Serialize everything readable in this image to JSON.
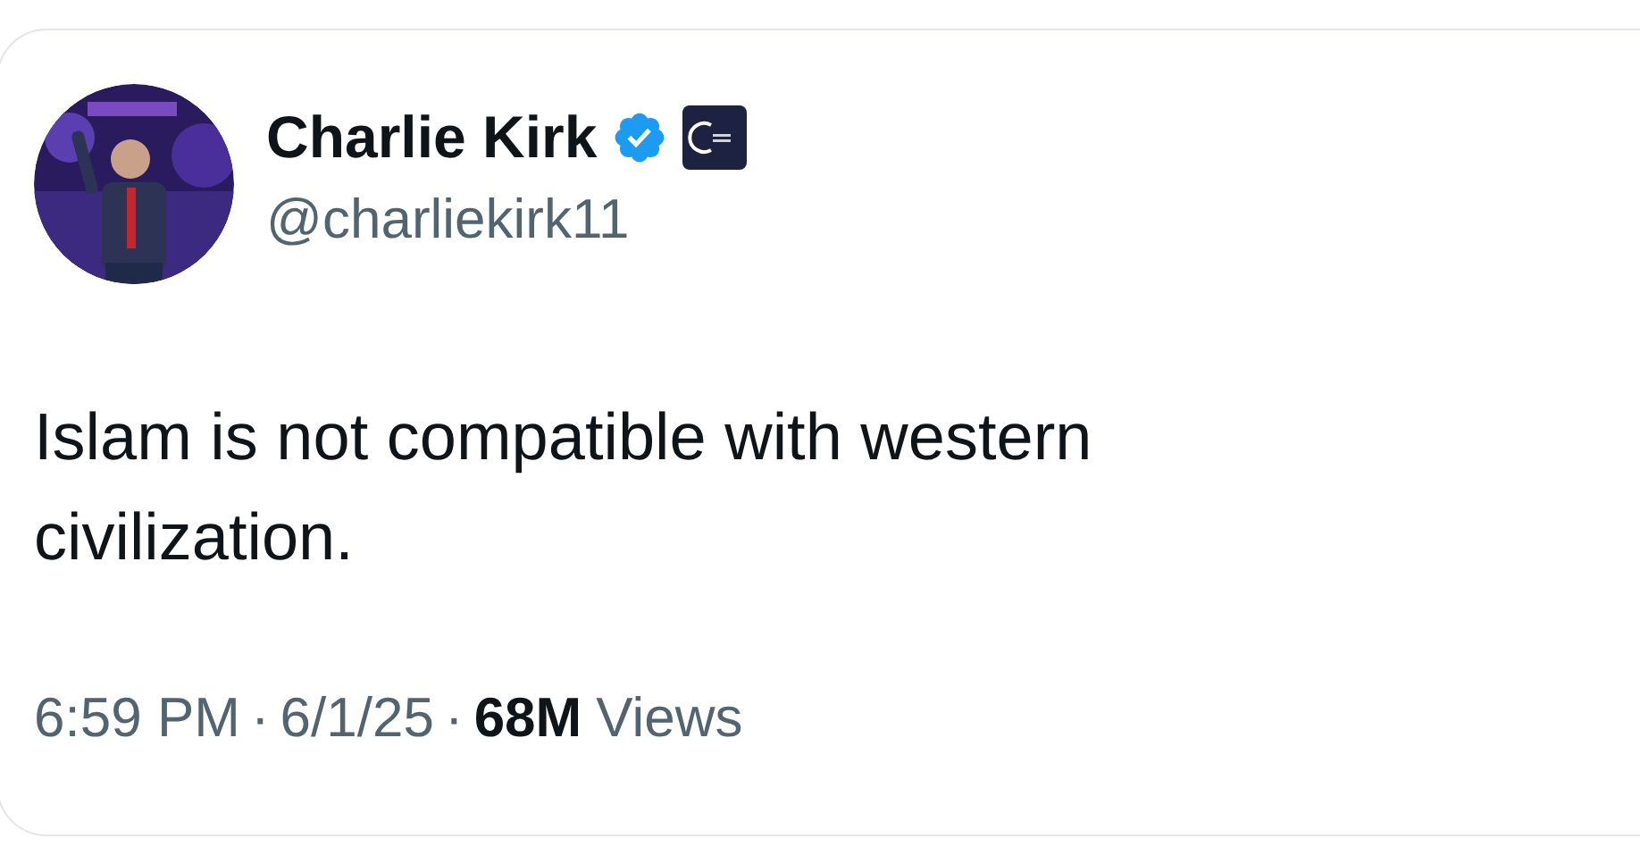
{
  "author": {
    "name": "Charlie Kirk",
    "verified": true,
    "handle": "@charliekirk11"
  },
  "text": "Islam is not compatible with western civilization.",
  "meta": {
    "time": "6:59 PM",
    "separator_1": "·",
    "date": "6/1/25",
    "separator_2": "·",
    "views_count": "68M",
    "views_label": "Views"
  }
}
